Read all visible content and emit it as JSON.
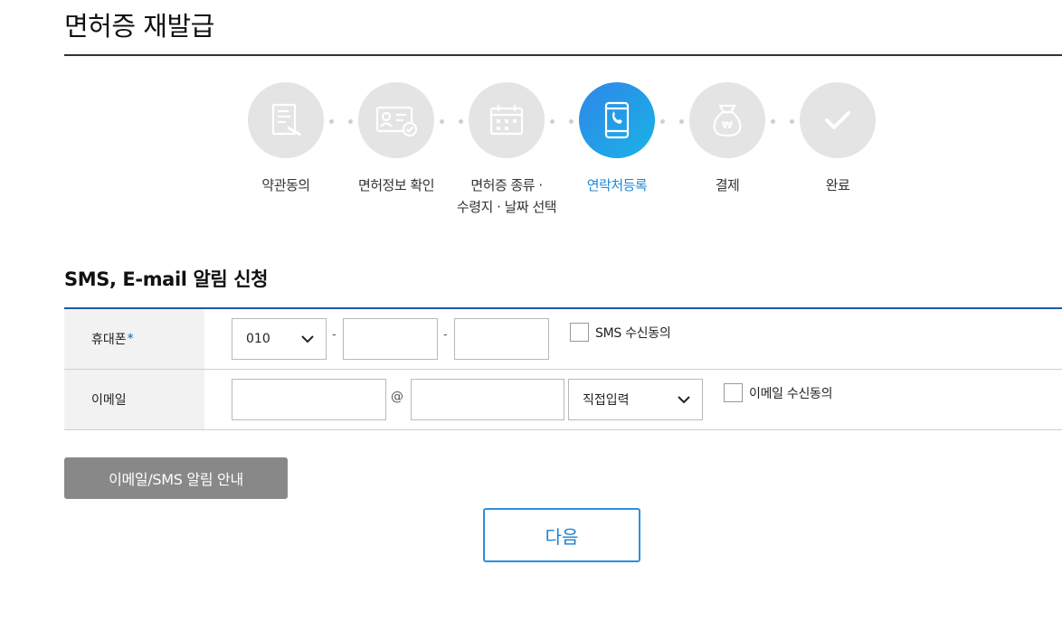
{
  "page": {
    "title": "면허증 재발급"
  },
  "steps": [
    {
      "label": "약관동의",
      "icon": "document-sign-icon",
      "active": false
    },
    {
      "label": "면허정보 확인",
      "icon": "id-card-check-icon",
      "active": false
    },
    {
      "label_line1": "면허증 종류 ·",
      "label_line2": "수령지 · 날짜 선택",
      "icon": "calendar-icon",
      "active": false
    },
    {
      "label": "연락처등록",
      "icon": "smartphone-call-icon",
      "active": true
    },
    {
      "label": "결제",
      "icon": "won-money-bag-icon",
      "active": false
    },
    {
      "label": "완료",
      "icon": "checkmark-icon",
      "active": false
    }
  ],
  "section": {
    "title": "SMS, E-mail 알림 신청"
  },
  "form": {
    "phone": {
      "label": "휴대폰",
      "required_mark": "*",
      "prefix_value": "010",
      "separator": "-",
      "sms_consent_label": "SMS 수신동의"
    },
    "email": {
      "label": "이메일",
      "at_sign": "@",
      "domain_select_value": "직접입력",
      "email_consent_label": "이메일 수신동의"
    }
  },
  "buttons": {
    "info": "이메일/SMS 알림 안내",
    "next": "다음"
  },
  "colors": {
    "accent": "#1a5aa8",
    "active_step": "#1e8ad8",
    "inactive_circle": "#e4e4e4"
  }
}
